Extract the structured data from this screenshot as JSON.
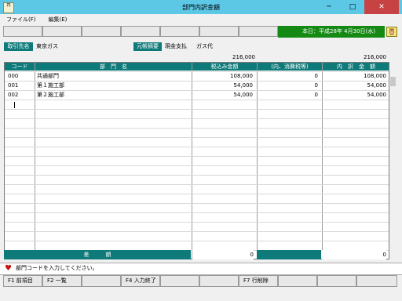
{
  "window": {
    "title": "部門内訳金額",
    "icon_text": "円",
    "minimize": "─",
    "maximize": "□",
    "close": "✕"
  },
  "menu": [
    {
      "label": "ファイル(F)"
    },
    {
      "label": "編集(E)"
    }
  ],
  "toolbar": {
    "date_label": "本日：平成28年 4月30日(水)",
    "mascot_icon": "owl-icon"
  },
  "header_info": {
    "partner_label": "取引先名",
    "partner_value": "東京ガス",
    "summary_label": "元帳摘要",
    "summary_value_1": "現金支払",
    "summary_value_2": "ガス代"
  },
  "totals_top": {
    "amount_incl": "216,000",
    "amount_breakdown": "216,000"
  },
  "table": {
    "headers": [
      "コード",
      "部　門　名",
      "税込み金額",
      "(内、消費税等)",
      "内　訳　金　額"
    ],
    "rows": [
      {
        "code": "000",
        "name": "共通部門",
        "amount": "108,000",
        "tax": "0",
        "breakdown": "108,000"
      },
      {
        "code": "001",
        "name": "第１施工部",
        "amount": "54,000",
        "tax": "0",
        "breakdown": "54,000"
      },
      {
        "code": "002",
        "name": "第２施工部",
        "amount": "54,000",
        "tax": "0",
        "breakdown": "54,000"
      }
    ]
  },
  "difference": {
    "label": "差　　　額",
    "amount": "0",
    "breakdown": "0"
  },
  "status": {
    "message": "部門コードを入力してください。",
    "icon": "heart-icon",
    "icon_color": "#d01010"
  },
  "function_keys": [
    {
      "label": "F1 前項目"
    },
    {
      "label": "F2 一覧"
    },
    {
      "label": ""
    },
    {
      "label": "F4 入力終了"
    },
    {
      "label": ""
    },
    {
      "label": ""
    },
    {
      "label": "F7 行削除"
    },
    {
      "label": ""
    },
    {
      "label": ""
    },
    {
      "label": ""
    }
  ],
  "colors": {
    "accent_teal": "#0e7a79",
    "date_green": "#148a14",
    "titlebar": "#5cc8e6",
    "close_red": "#c74343"
  }
}
